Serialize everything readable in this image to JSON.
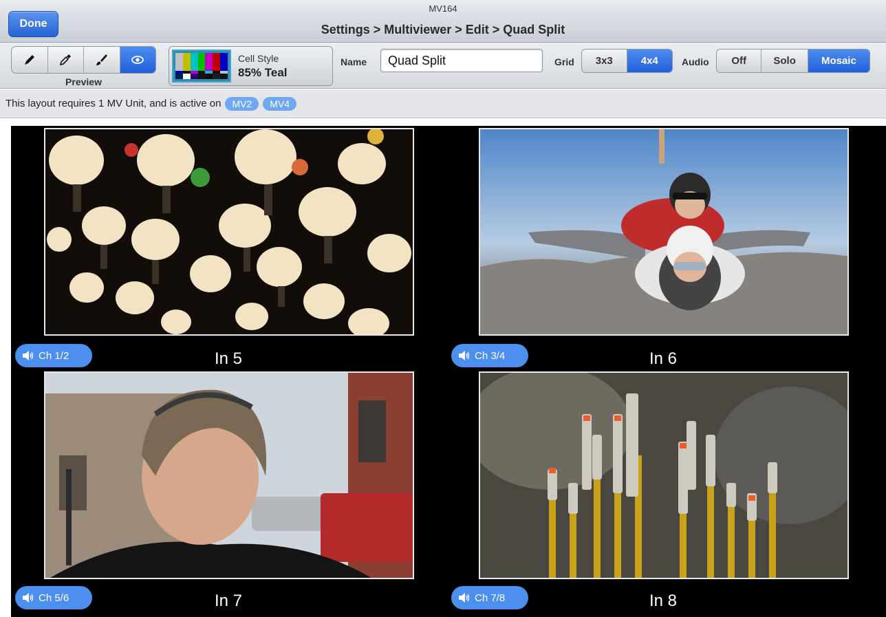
{
  "title_bar": {
    "done_label": "Done",
    "app_name": "MV164",
    "breadcrumb": "Settings > Multiviewer > Edit > Quad Split"
  },
  "toolbar": {
    "tools": [
      {
        "icon": "pencil-icon",
        "active": false
      },
      {
        "icon": "eyedropper-icon",
        "active": false
      },
      {
        "icon": "paintbrush-icon",
        "active": false
      },
      {
        "icon": "eye-icon",
        "active": true
      }
    ],
    "preview_label": "Preview",
    "cell_style": {
      "label": "Cell Style",
      "value": "85% Teal",
      "swatch_color": "#2a8fb0"
    },
    "name": {
      "label": "Name",
      "value": "Quad Split"
    },
    "grid": {
      "label": "Grid",
      "options": [
        "3x3",
        "4x4"
      ],
      "selected": "4x4"
    },
    "audio": {
      "label": "Audio",
      "options": [
        "Off",
        "Solo",
        "Mosaic"
      ],
      "selected": "Mosaic"
    }
  },
  "info_bar": {
    "text": "This layout requires 1 MV Unit, and is active on",
    "units": [
      "MV2",
      "MV4"
    ]
  },
  "cells": [
    {
      "label": "In 5",
      "audio": "Ch 1/2",
      "image": "lanterns"
    },
    {
      "label": "In 6",
      "audio": "Ch 3/4",
      "image": "skydivers"
    },
    {
      "label": "In 7",
      "audio": "Ch 5/6",
      "image": "man-portrait"
    },
    {
      "label": "In 8",
      "audio": "Ch 7/8",
      "image": "incense-sticks"
    }
  ],
  "colors": {
    "accent": "#2763d6",
    "pill": "#4d8fee",
    "background": "#000000"
  }
}
